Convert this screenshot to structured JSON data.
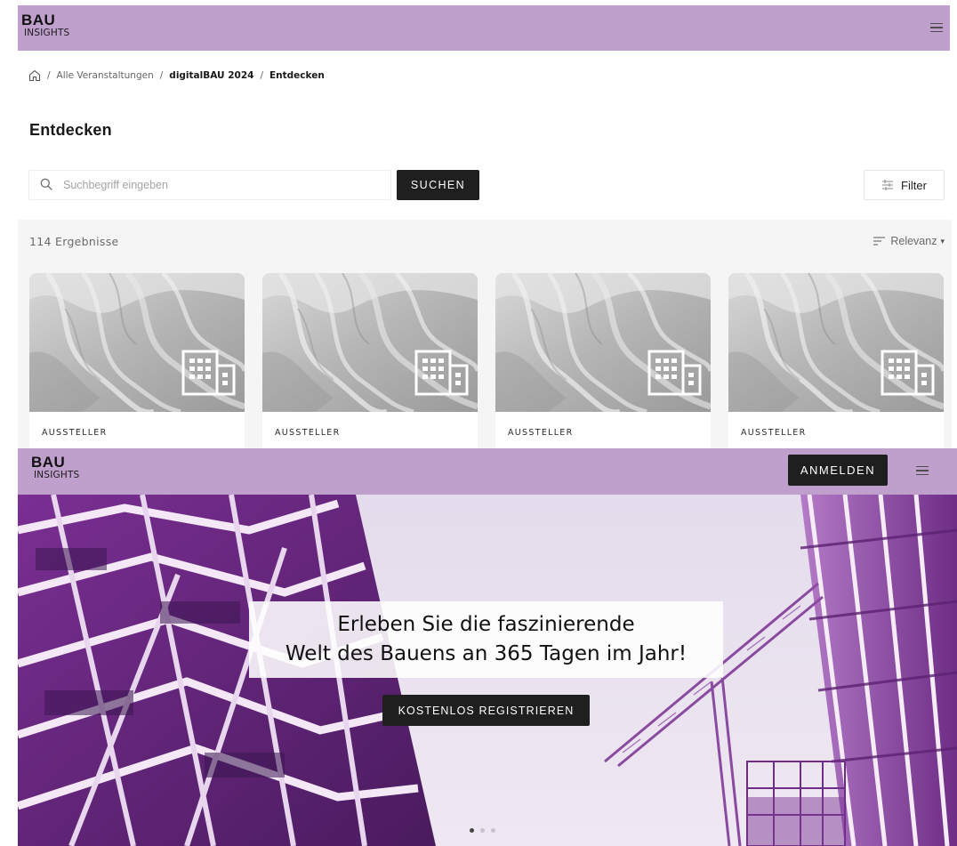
{
  "colors": {
    "header_bg": "#bf9fcb",
    "button_bg": "#1f1f1f",
    "results_bg": "#f5f5f5",
    "hero_tint": "#8e3fa2"
  },
  "top": {
    "logo": {
      "line1": "BAU",
      "line2": "INSIGHTS"
    },
    "menu_icon": "hamburger-icon",
    "breadcrumb": {
      "home_icon": "home-icon",
      "separator": "/",
      "items": [
        "Alle Veranstaltungen",
        "digitalBAU 2024",
        "Entdecken"
      ]
    },
    "page_title": "Entdecken",
    "search": {
      "placeholder": "Suchbegriff eingeben",
      "value": "",
      "icon": "search-icon",
      "button_label": "SUCHEN"
    },
    "filter": {
      "icon": "sliders-icon",
      "label": "Filter"
    },
    "results": {
      "count_text": "114 Ergebnisse",
      "sort_icon": "sort-lines-icon",
      "sort_label": "Relevanz",
      "sort_caret": "▾"
    },
    "cards": [
      {
        "category": "AUSSTELLER",
        "icon": "building-icon"
      },
      {
        "category": "AUSSTELLER",
        "icon": "building-icon"
      },
      {
        "category": "AUSSTELLER",
        "icon": "building-icon"
      },
      {
        "category": "AUSSTELLER",
        "icon": "building-icon"
      }
    ]
  },
  "bottom": {
    "logo": {
      "line1": "BAU",
      "line2": "INSIGHTS"
    },
    "login_label": "ANMELDEN",
    "menu_icon": "hamburger-icon",
    "hero": {
      "headline_line1": "Erleben Sie die faszinierende",
      "headline_line2": "Welt des Bauens an 365 Tagen im Jahr!",
      "cta_label": "KOSTENLOS REGISTRIEREN",
      "slides_total": 3,
      "active_slide": 1
    }
  }
}
